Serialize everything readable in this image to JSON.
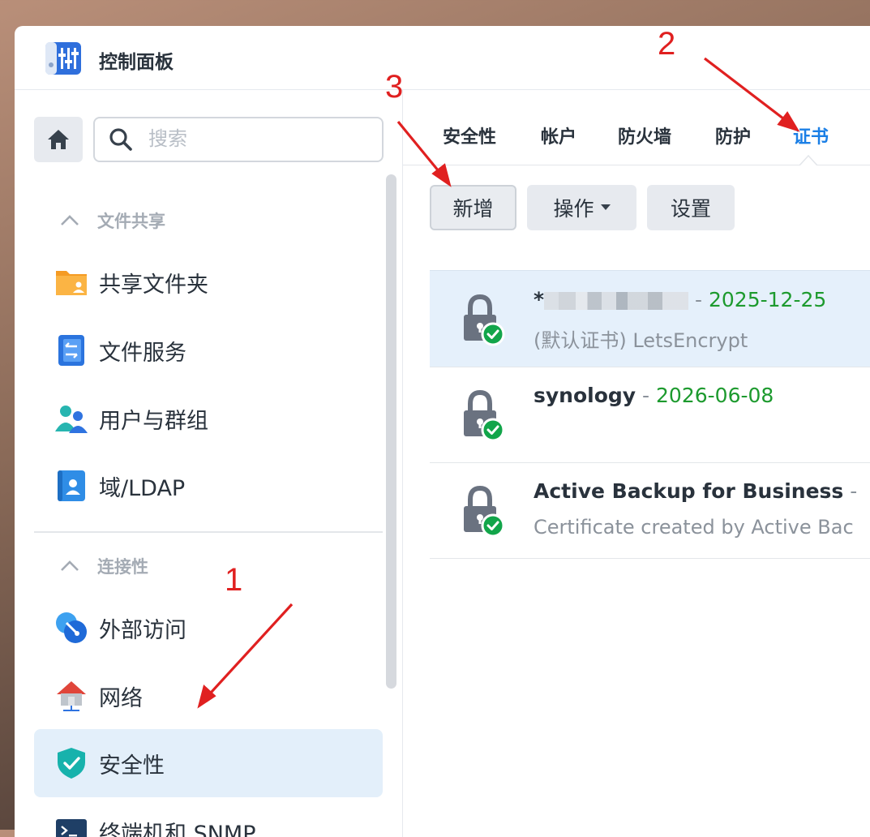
{
  "app": {
    "title": "控制面板",
    "icon": "control-panel-icon"
  },
  "search": {
    "placeholder": "搜索",
    "icon": "search-icon"
  },
  "sidebar": {
    "groups": [
      {
        "label": "文件共享",
        "items": [
          {
            "label": "共享文件夹",
            "icon": "shared-folder-icon"
          },
          {
            "label": "文件服务",
            "icon": "file-services-icon"
          },
          {
            "label": "用户与群组",
            "icon": "users-groups-icon"
          },
          {
            "label": "域/LDAP",
            "icon": "domain-ldap-icon"
          }
        ]
      },
      {
        "label": "连接性",
        "items": [
          {
            "label": "外部访问",
            "icon": "external-access-icon"
          },
          {
            "label": "网络",
            "icon": "network-icon"
          },
          {
            "label": "安全性",
            "icon": "security-shield-icon",
            "active": true
          },
          {
            "label": "终端机和 SNMP",
            "icon": "terminal-icon"
          }
        ]
      }
    ]
  },
  "tabs": [
    {
      "label": "安全性"
    },
    {
      "label": "帐户"
    },
    {
      "label": "防火墙"
    },
    {
      "label": "防护"
    },
    {
      "label": "证书",
      "active": true
    }
  ],
  "toolbar": {
    "add": "新增",
    "action": "操作",
    "settings": "设置"
  },
  "certificates": [
    {
      "name_prefix": "*",
      "sep": " - ",
      "date": "2025-12-25",
      "desc": "(默认证书) LetsEncrypt",
      "selected": true,
      "name_redacted": true
    },
    {
      "name": "synology",
      "sep": " - ",
      "date": "2026-06-08",
      "desc": ""
    },
    {
      "name": "Active Backup for Business",
      "sep": " -",
      "date": "",
      "desc": "Certificate created by Active Bac"
    }
  ],
  "annotations": [
    "1",
    "2",
    "3"
  ],
  "colors": {
    "accent": "#1b7fe6",
    "date_green": "#1d9a2e",
    "annotation_red": "#e02020",
    "selected_bg": "#e3effa"
  }
}
